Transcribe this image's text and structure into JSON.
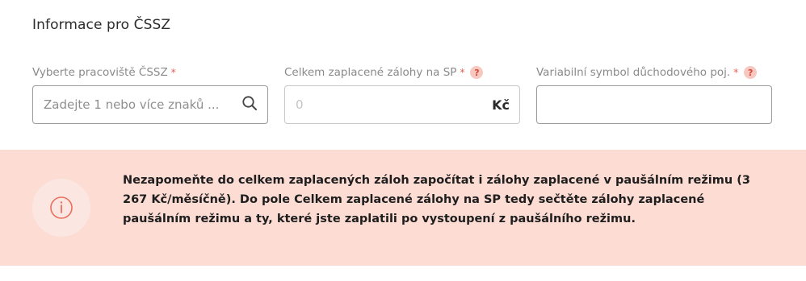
{
  "section": {
    "title": "Informace pro ČSSZ"
  },
  "fields": {
    "workplace": {
      "label": "Vyberte pracoviště ČSSZ",
      "required_mark": "*",
      "placeholder": "Zadejte 1 nebo více znaků ...",
      "icon": "search-icon"
    },
    "advances": {
      "label": "Celkem zaplacené zálohy na SP",
      "required_mark": "*",
      "help": "?",
      "value": "0",
      "suffix": "Kč"
    },
    "variable_symbol": {
      "label": "Variabilní symbol důchodového poj.",
      "required_mark": "*",
      "help": "?",
      "value": ""
    }
  },
  "alert": {
    "icon": "info-icon",
    "text": "Nezapomeňte do celkem zaplacených záloh započítat i zálohy zaplacené v paušálním režimu (3 267 Kč/měsíčně). Do pole Celkem zaplacené zálohy na SP tedy sečtěte zálohy zaplacené paušálním režimu a ty, které jste zaplatili po vystoupení z paušálního režimu."
  },
  "colors": {
    "accent": "#e45a4c",
    "alert_bg": "#fddcd4",
    "help_bg": "#f6c8c0"
  }
}
